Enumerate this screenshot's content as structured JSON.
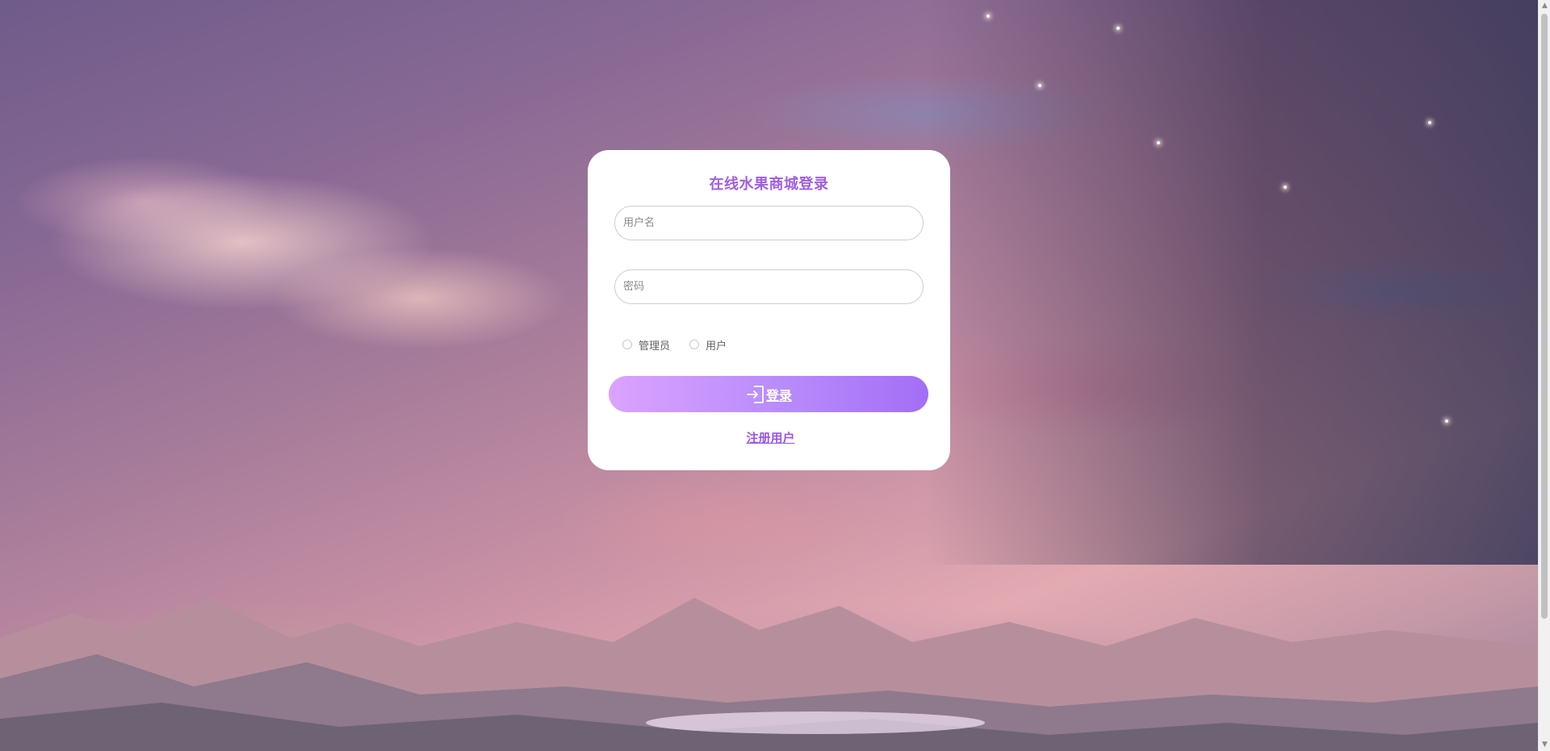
{
  "login": {
    "title": "在线水果商城登录",
    "username_placeholder": "用户名",
    "password_placeholder": "密码",
    "username_value": "",
    "password_value": "",
    "roles": [
      {
        "label": "管理员",
        "selected": false
      },
      {
        "label": "用户",
        "selected": false
      }
    ],
    "login_button_label": "登录",
    "register_link_label": "注册用户"
  },
  "icons": {
    "login_icon": "sign-in-icon",
    "scroll_up": "triangle-up-icon",
    "scroll_down": "triangle-down-icon"
  },
  "colors": {
    "accent": "#a05fe0",
    "button_gradient_start": "#dba3ff",
    "button_gradient_end": "#a36ef6",
    "link": "#9b55e8"
  }
}
